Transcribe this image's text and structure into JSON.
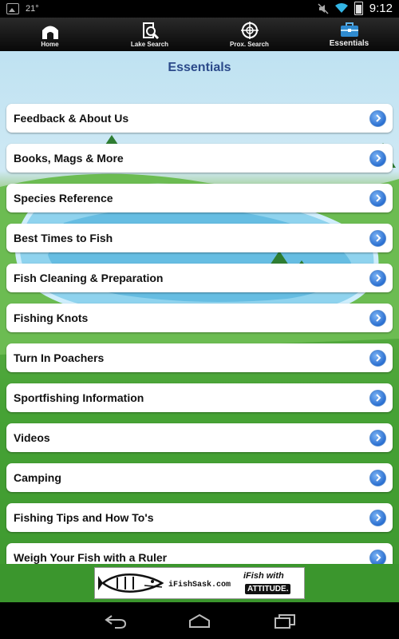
{
  "status_bar": {
    "temperature": "21°",
    "time": "9:12"
  },
  "tabs": [
    {
      "label": "Home",
      "icon": "home-icon",
      "active": false
    },
    {
      "label": "Lake Search",
      "icon": "lake-search-icon",
      "active": false
    },
    {
      "label": "Prox. Search",
      "icon": "crosshair-icon",
      "active": false
    },
    {
      "label": "Essentials",
      "icon": "toolbox-icon",
      "active": true
    }
  ],
  "page": {
    "title": "Essentials"
  },
  "menu": [
    {
      "label": "Feedback & About Us"
    },
    {
      "label": "Books, Mags & More"
    },
    {
      "label": "Species Reference"
    },
    {
      "label": "Best Times to Fish"
    },
    {
      "label": "Fish Cleaning & Preparation"
    },
    {
      "label": "Fishing Knots"
    },
    {
      "label": "Turn In Poachers"
    },
    {
      "label": "Sportfishing Information"
    },
    {
      "label": "Videos"
    },
    {
      "label": "Camping"
    },
    {
      "label": "Fishing Tips and How To's"
    },
    {
      "label": "Weigh Your Fish with a Ruler"
    }
  ],
  "ad": {
    "brand": "iFishSask.com",
    "tagline_top": "iFish with",
    "tagline_bottom": "ATTITUDE."
  },
  "colors": {
    "title_blue": "#2b4a8a",
    "chevron_blue": "#2a6fd1",
    "grass_green": "#46a235",
    "sky_blue": "#bfe2f2"
  }
}
